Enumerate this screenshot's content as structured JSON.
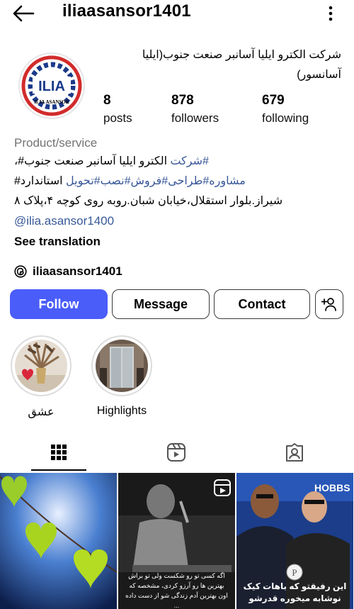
{
  "header": {
    "username": "iliaasansor1401"
  },
  "profile": {
    "full_name": "شرکت الکترو ایلیا آسانبر صنعت جنوب(ایلیا آسانسور)",
    "avatar_text": "ILIA",
    "avatar_subtext": "ILIA ASANSOR",
    "stats": [
      {
        "value": "8",
        "label": "posts"
      },
      {
        "value": "878",
        "label": "followers"
      },
      {
        "value": "679",
        "label": "following"
      }
    ],
    "category": "Product/service",
    "bio": {
      "line1_hash": "#شرکت",
      "line1_text": " الکترو ایلیا آسانبر صنعت جنوب#،",
      "line2_hashes": "مشاوره#طراحی#فروش#نصب#تحویل",
      "line2_text": " استاندارد#",
      "line3": "شیراز.بلوار استقلال،خیابان شبان.روبه روی کوچه ۴،پلاک ۸"
    },
    "mention": "@ilia.asansor1400",
    "see_translation": "See translation",
    "threads_handle": "iliaasansor1401"
  },
  "actions": {
    "follow": "Follow",
    "message": "Message",
    "contact": "Contact"
  },
  "highlights": [
    {
      "label": "عشق"
    },
    {
      "label": "Highlights"
    }
  ],
  "tabs": [
    {
      "name": "grid-tab",
      "icon": "grid-icon",
      "active": true
    },
    {
      "name": "reels-tab",
      "icon": "reels-icon",
      "active": false
    },
    {
      "name": "tagged-tab",
      "icon": "tagged-icon",
      "active": false
    }
  ],
  "posts": [
    {
      "caption": ""
    },
    {
      "caption": "اگه کسی تو رو شکست ولی تو براش بهترین ها رو آرزو کردی، مشخصه که اون بهترین آدم زندگی شو از دست داده ..."
    },
    {
      "caption": "این رفیقتو که باهات کیک نوشابه میخوره قدرشو بدون",
      "banner": "HOBBS"
    }
  ],
  "colors": {
    "follow_button": "#4a5df9",
    "link": "#385898",
    "category": "#737373"
  }
}
